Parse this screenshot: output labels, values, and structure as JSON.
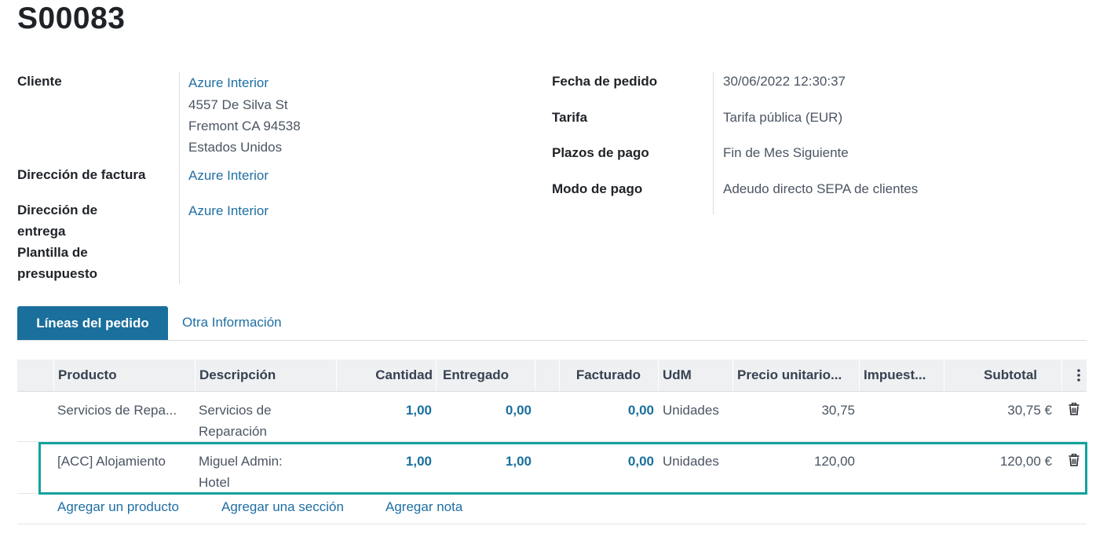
{
  "order": {
    "title": "S00083"
  },
  "left_fields": {
    "customer_label": "Cliente",
    "customer_name": "Azure Interior",
    "customer_address": [
      "4557 De Silva St",
      "Fremont CA 94538",
      "Estados Unidos"
    ],
    "invoice_address_label": "Dirección de factura",
    "invoice_address_value": "Azure Interior",
    "delivery_address_label_line1": "Dirección de",
    "delivery_address_label_line2": "entrega",
    "delivery_address_value": "Azure Interior",
    "quote_template_label_line1": "Plantilla de",
    "quote_template_label_line2": "presupuesto"
  },
  "right_fields": {
    "order_date_label": "Fecha de pedido",
    "order_date_value": "30/06/2022 12:30:37",
    "pricelist_label": "Tarifa",
    "pricelist_value": "Tarifa pública (EUR)",
    "payment_terms_label": "Plazos de pago",
    "payment_terms_value": "Fin de Mes Siguiente",
    "payment_mode_label": "Modo de pago",
    "payment_mode_value": "Adeudo directo SEPA de clientes"
  },
  "tabs": [
    {
      "label": "Líneas del pedido",
      "active": true
    },
    {
      "label": "Otra Información",
      "active": false
    }
  ],
  "table": {
    "columns": [
      "Producto",
      "Descripción",
      "Cantidad",
      "Entregado",
      "Facturado",
      "UdM",
      "Precio unitario...",
      "Impuest...",
      "Subtotal"
    ],
    "rows": [
      {
        "product": "Servicios de Repa...",
        "description_line1": "Servicios de",
        "description_line2": "Reparación",
        "quantity": "1,00",
        "delivered": "0,00",
        "invoiced": "0,00",
        "uom": "Unidades",
        "unit_price": "30,75",
        "taxes": "",
        "subtotal": "30,75 €"
      },
      {
        "product": "[ACC] Alojamiento",
        "description_line1": "Miguel Admin:",
        "description_line2": "Hotel",
        "quantity": "1,00",
        "delivered": "1,00",
        "invoiced": "0,00",
        "uom": "Unidades",
        "unit_price": "120,00",
        "taxes": "",
        "subtotal": "120,00 €",
        "selected": true
      }
    ],
    "add_actions": [
      "Agregar un producto",
      "Agregar una sección",
      "Agregar nota"
    ]
  },
  "colors": {
    "accent": "#1a6f9d",
    "link": "#1f6fa3",
    "selection_border": "#14a29d",
    "header_bg": "#eef0f2"
  },
  "icons": {
    "column_options": "vertical-dots-icon",
    "delete_line": "trash-icon"
  }
}
